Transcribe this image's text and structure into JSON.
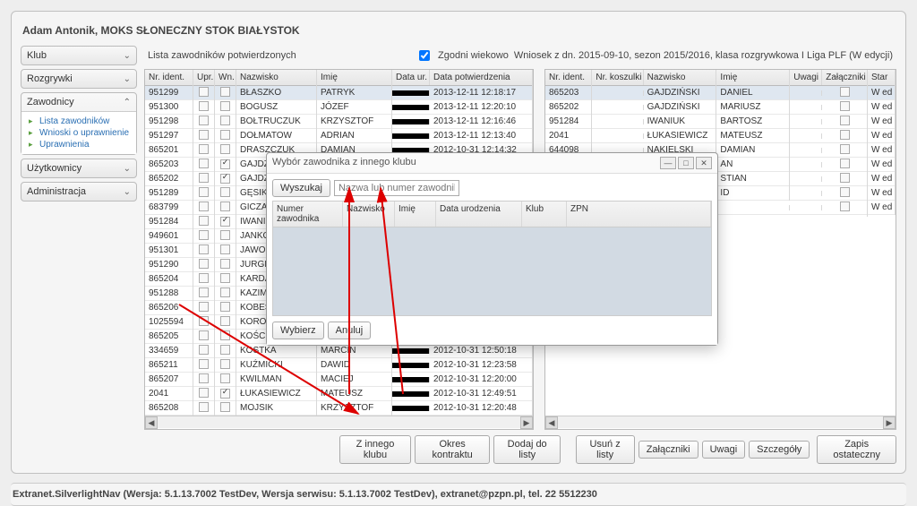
{
  "page_title": "Adam Antonik, MOKS SŁONECZNY STOK BIAŁYSTOK",
  "sidebar": {
    "items": [
      "Klub",
      "Rozgrywki",
      "Zawodnicy",
      "Użytkownicy",
      "Administracja"
    ],
    "zawodnicy_links": [
      "Lista zawodników",
      "Wnioski o uprawnienie",
      "Uprawnienia"
    ]
  },
  "list_header": {
    "title": "Lista zawodników potwierdzonych",
    "zgodni": "Zgodni wiekowo",
    "wniosek": "Wniosek z dn. 2015-09-10, sezon 2015/2016, klasa rozgrywkowa I Liga PLF (W edycji)"
  },
  "left_cols": [
    "Nr. ident.",
    "Upr.",
    "Wn.",
    "Nazwisko",
    "Imię",
    "Data ur.",
    "Data potwierdzenia"
  ],
  "right_cols": [
    "Nr. ident.",
    "Nr. koszulki",
    "Nazwisko",
    "Imię",
    "Uwagi",
    "Załączniki",
    "Star"
  ],
  "left_rows": [
    {
      "nr": "951299",
      "wn": false,
      "nazw": "BŁASZKO",
      "imie": "PATRYK",
      "datap": "2013-12-11 12:18:17"
    },
    {
      "nr": "951300",
      "wn": false,
      "nazw": "BOGUSZ",
      "imie": "JÓZEF",
      "datap": "2013-12-11 12:20:10"
    },
    {
      "nr": "951298",
      "wn": false,
      "nazw": "BOŁTRUCZUK",
      "imie": "KRZYSZTOF",
      "datap": "2013-12-11 12:16:46"
    },
    {
      "nr": "951297",
      "wn": false,
      "nazw": "DOŁMATOW",
      "imie": "ADRIAN",
      "datap": "2013-12-11 12:13:40"
    },
    {
      "nr": "865201",
      "wn": false,
      "nazw": "DRASZCZUK",
      "imie": "DAMIAN",
      "datap": "2012-10-31 12:14:32"
    },
    {
      "nr": "865203",
      "wn": true,
      "nazw": "GAJDZIŃS",
      "imie": "",
      "datap": ""
    },
    {
      "nr": "865202",
      "wn": true,
      "nazw": "GAJDZIŃS",
      "imie": "",
      "datap": ""
    },
    {
      "nr": "951289",
      "wn": false,
      "nazw": "GĘSIKOWS",
      "imie": "",
      "datap": ""
    },
    {
      "nr": "683799",
      "wn": false,
      "nazw": "GICZAN",
      "imie": "",
      "datap": ""
    },
    {
      "nr": "951284",
      "wn": true,
      "nazw": "IWANIUK",
      "imie": "",
      "datap": ""
    },
    {
      "nr": "949601",
      "wn": false,
      "nazw": "JANKOWS",
      "imie": "",
      "datap": ""
    },
    {
      "nr": "951301",
      "wn": false,
      "nazw": "JAWOROW",
      "imie": "",
      "datap": ""
    },
    {
      "nr": "951290",
      "wn": false,
      "nazw": "JURGIELAM",
      "imie": "",
      "datap": ""
    },
    {
      "nr": "865204",
      "wn": false,
      "nazw": "KARDASZ",
      "imie": "",
      "datap": ""
    },
    {
      "nr": "951288",
      "wn": false,
      "nazw": "KAZIMIER",
      "imie": "",
      "datap": ""
    },
    {
      "nr": "865206",
      "wn": false,
      "nazw": "KOBESZKO",
      "imie": "",
      "datap": ""
    },
    {
      "nr": "1025594",
      "wn": false,
      "nazw": "KOROTKIE",
      "imie": "",
      "datap": ""
    },
    {
      "nr": "865205",
      "wn": false,
      "nazw": "KOŚCIUK",
      "imie": "",
      "datap": ""
    },
    {
      "nr": "334659",
      "wn": false,
      "nazw": "KOSTKA",
      "imie": "MARCIN",
      "datap": "2012-10-31 12:50:18"
    },
    {
      "nr": "865211",
      "wn": false,
      "nazw": "KUŹMICKI",
      "imie": "DAWID",
      "datap": "2012-10-31 12:23:58"
    },
    {
      "nr": "865207",
      "wn": false,
      "nazw": "KWILMAN",
      "imie": "MACIEJ",
      "datap": "2012-10-31 12:20:00"
    },
    {
      "nr": "2041",
      "wn": true,
      "nazw": "ŁUKASIEWICZ",
      "imie": "MATEUSZ",
      "datap": "2012-10-31 12:49:51"
    },
    {
      "nr": "865208",
      "wn": false,
      "nazw": "MOJSIK",
      "imie": "KRZYSZTOF",
      "datap": "2012-10-31 12:20:48"
    }
  ],
  "right_rows": [
    {
      "nr": "865203",
      "nazw": "GAJDZIŃSKI",
      "imie": "DANIEL",
      "star": "W ed"
    },
    {
      "nr": "865202",
      "nazw": "GAJDZIŃSKI",
      "imie": "MARIUSZ",
      "star": "W ed"
    },
    {
      "nr": "951284",
      "nazw": "IWANIUK",
      "imie": "BARTOSZ",
      "star": "W ed"
    },
    {
      "nr": "2041",
      "nazw": "ŁUKASIEWICZ",
      "imie": "MATEUSZ",
      "star": "W ed"
    },
    {
      "nr": "644098",
      "nazw": "NAKIELSKI",
      "imie": "DAMIAN",
      "star": "W ed"
    },
    {
      "nr": "",
      "nazw": "",
      "imie": "AN",
      "star": "W ed"
    },
    {
      "nr": "",
      "nazw": "",
      "imie": "STIAN",
      "star": "W ed"
    },
    {
      "nr": "",
      "nazw": "",
      "imie": "ID",
      "star": "W ed"
    },
    {
      "nr": "",
      "nazw": "",
      "imie": "",
      "star": "W ed"
    }
  ],
  "buttons": {
    "z_innego": "Z innego klubu",
    "okres": "Okres kontraktu",
    "dodaj": "Dodaj do listy",
    "usun": "Usuń z listy",
    "zalaczniki": "Załączniki",
    "uwagi": "Uwagi",
    "szczegoly": "Szczegóły",
    "zapis": "Zapis ostateczny"
  },
  "modal": {
    "title": "Wybór zawodnika z innego klubu",
    "wyszukaj": "Wyszukaj",
    "placeholder": "Nazwa lub numer zawodnika",
    "cols": [
      "Numer zawodnika",
      "Nazwisko",
      "Imię",
      "Data urodzenia",
      "Klub",
      "ZPN"
    ],
    "wybierz": "Wybierz",
    "anuluj": "Anuluj"
  },
  "footer": "Extranet.SilverlightNav (Wersja: 5.1.13.7002 TestDev, Wersja serwisu: 5.1.13.7002 TestDev), extranet@pzpn.pl, tel. 22 5512230"
}
